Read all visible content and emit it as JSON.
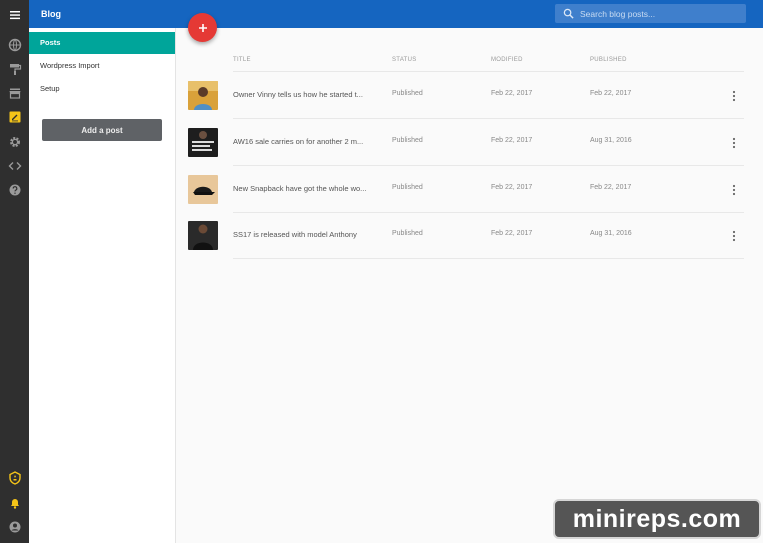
{
  "topbar": {
    "title": "Blog",
    "search_placeholder": "Search blog posts..."
  },
  "rail": {
    "icons": [
      "menu-icon",
      "globe-icon",
      "paint-roller-icon",
      "store-icon",
      "blog-icon",
      "gear-icon",
      "code-icon",
      "help-icon",
      "shield-icon",
      "bell-icon",
      "account-icon"
    ],
    "active_icon_color": "#f5c518"
  },
  "sidebar": {
    "items": [
      {
        "label": "Posts"
      },
      {
        "label": "Wordpress Import"
      },
      {
        "label": "Setup"
      }
    ],
    "add_post_label": "Add a post"
  },
  "fab": {
    "label": "+"
  },
  "table": {
    "headers": {
      "title": "TITLE",
      "status": "STATUS",
      "modified": "MODIFIED",
      "published": "PUBLISHED"
    },
    "rows": [
      {
        "title": "Owner Vinny tells us how he started t...",
        "status": "Published",
        "modified": "Feb 22, 2017",
        "published": "Feb 22, 2017"
      },
      {
        "title": "AW16 sale carries on for another 2 m...",
        "status": "Published",
        "modified": "Feb 22, 2017",
        "published": "Aug 31, 2016"
      },
      {
        "title": "New Snapback have got the whole wo...",
        "status": "Published",
        "modified": "Feb 22, 2017",
        "published": "Feb 22, 2017"
      },
      {
        "title": "SS17 is released with model Anthony",
        "status": "Published",
        "modified": "Feb 22, 2017",
        "published": "Aug 31, 2016"
      }
    ]
  },
  "watermark": {
    "text": "minireps.com"
  },
  "colors": {
    "topbar": "#1565c0",
    "rail": "#2f2f2f",
    "active_nav": "#00a59a",
    "fab": "#e53935",
    "add_button": "#5f6266"
  }
}
